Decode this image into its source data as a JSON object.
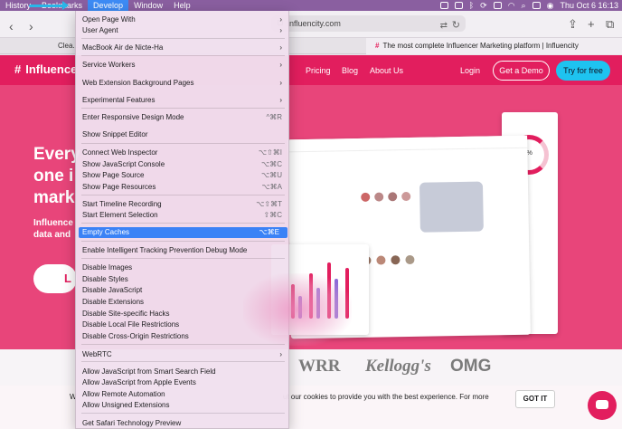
{
  "menubar": {
    "items": [
      "History",
      "Bookmarks",
      "Develop",
      "Window",
      "Help"
    ],
    "clock": "Thu Oct 6  16:13"
  },
  "browser": {
    "url": "influencity.com",
    "tabs": [
      {
        "label": "Clea..."
      },
      {
        "label": "The most complete Influencer Marketing platform | Influencity"
      }
    ]
  },
  "site": {
    "logo": "Influence",
    "nav": [
      "Pricing",
      "Blog",
      "About Us"
    ],
    "login": "Login",
    "demo": "Get a Demo",
    "free": "Try for free",
    "hero_lines": [
      "Every",
      "one i",
      "mark"
    ],
    "hero_sub_lines": [
      "Influence",
      "data and"
    ],
    "cta": "L",
    "gauge_value": "75.3%"
  },
  "brands": [
    "WRR",
    "Kellogg's",
    "OMG"
  ],
  "cookie": {
    "text_left": "W",
    "text": "ut our cookies to provide you with the best experience. For more",
    "button": "GOT IT"
  },
  "develop_menu": {
    "items": [
      {
        "label": "Open Page With",
        "submenu": true
      },
      {
        "label": "User Agent",
        "submenu": true
      },
      {
        "label": "MacBook Air de Nicte-Ha",
        "submenu": true
      },
      {
        "label": "Service Workers",
        "submenu": true
      },
      {
        "label": "Web Extension Background Pages",
        "submenu": true
      },
      {
        "label": "Experimental Features",
        "submenu": true
      },
      {
        "label": "Enter Responsive Design Mode",
        "shortcut": "^⌘R"
      },
      {
        "label": "Show Snippet Editor"
      },
      {
        "label": "Connect Web Inspector",
        "shortcut": "⌥⇧⌘I"
      },
      {
        "label": "Show JavaScript Console",
        "shortcut": "⌥⌘C"
      },
      {
        "label": "Show Page Source",
        "shortcut": "⌥⌘U"
      },
      {
        "label": "Show Page Resources",
        "shortcut": "⌥⌘A"
      },
      {
        "label": "Start Timeline Recording",
        "shortcut": "⌥⇧⌘T"
      },
      {
        "label": "Start Element Selection",
        "shortcut": "⇧⌘C"
      },
      {
        "label": "Empty Caches",
        "shortcut": "⌥⌘E",
        "highlighted": true
      },
      {
        "label": "Enable Intelligent Tracking Prevention Debug Mode"
      },
      {
        "label": "Disable Images"
      },
      {
        "label": "Disable Styles"
      },
      {
        "label": "Disable JavaScript"
      },
      {
        "label": "Disable Extensions"
      },
      {
        "label": "Disable Site-specific Hacks"
      },
      {
        "label": "Disable Local File Restrictions"
      },
      {
        "label": "Disable Cross-Origin Restrictions"
      },
      {
        "label": "WebRTC",
        "submenu": true
      },
      {
        "label": "Allow JavaScript from Smart Search Field"
      },
      {
        "label": "Allow JavaScript from Apple Events"
      },
      {
        "label": "Allow Remote Automation"
      },
      {
        "label": "Allow Unsigned Extensions"
      },
      {
        "label": "Get Safari Technology Preview"
      }
    ]
  },
  "colors": {
    "brand": "#e21e5e",
    "highlight": "#3b82f6",
    "annotation_arrow": "#29b6e8"
  }
}
